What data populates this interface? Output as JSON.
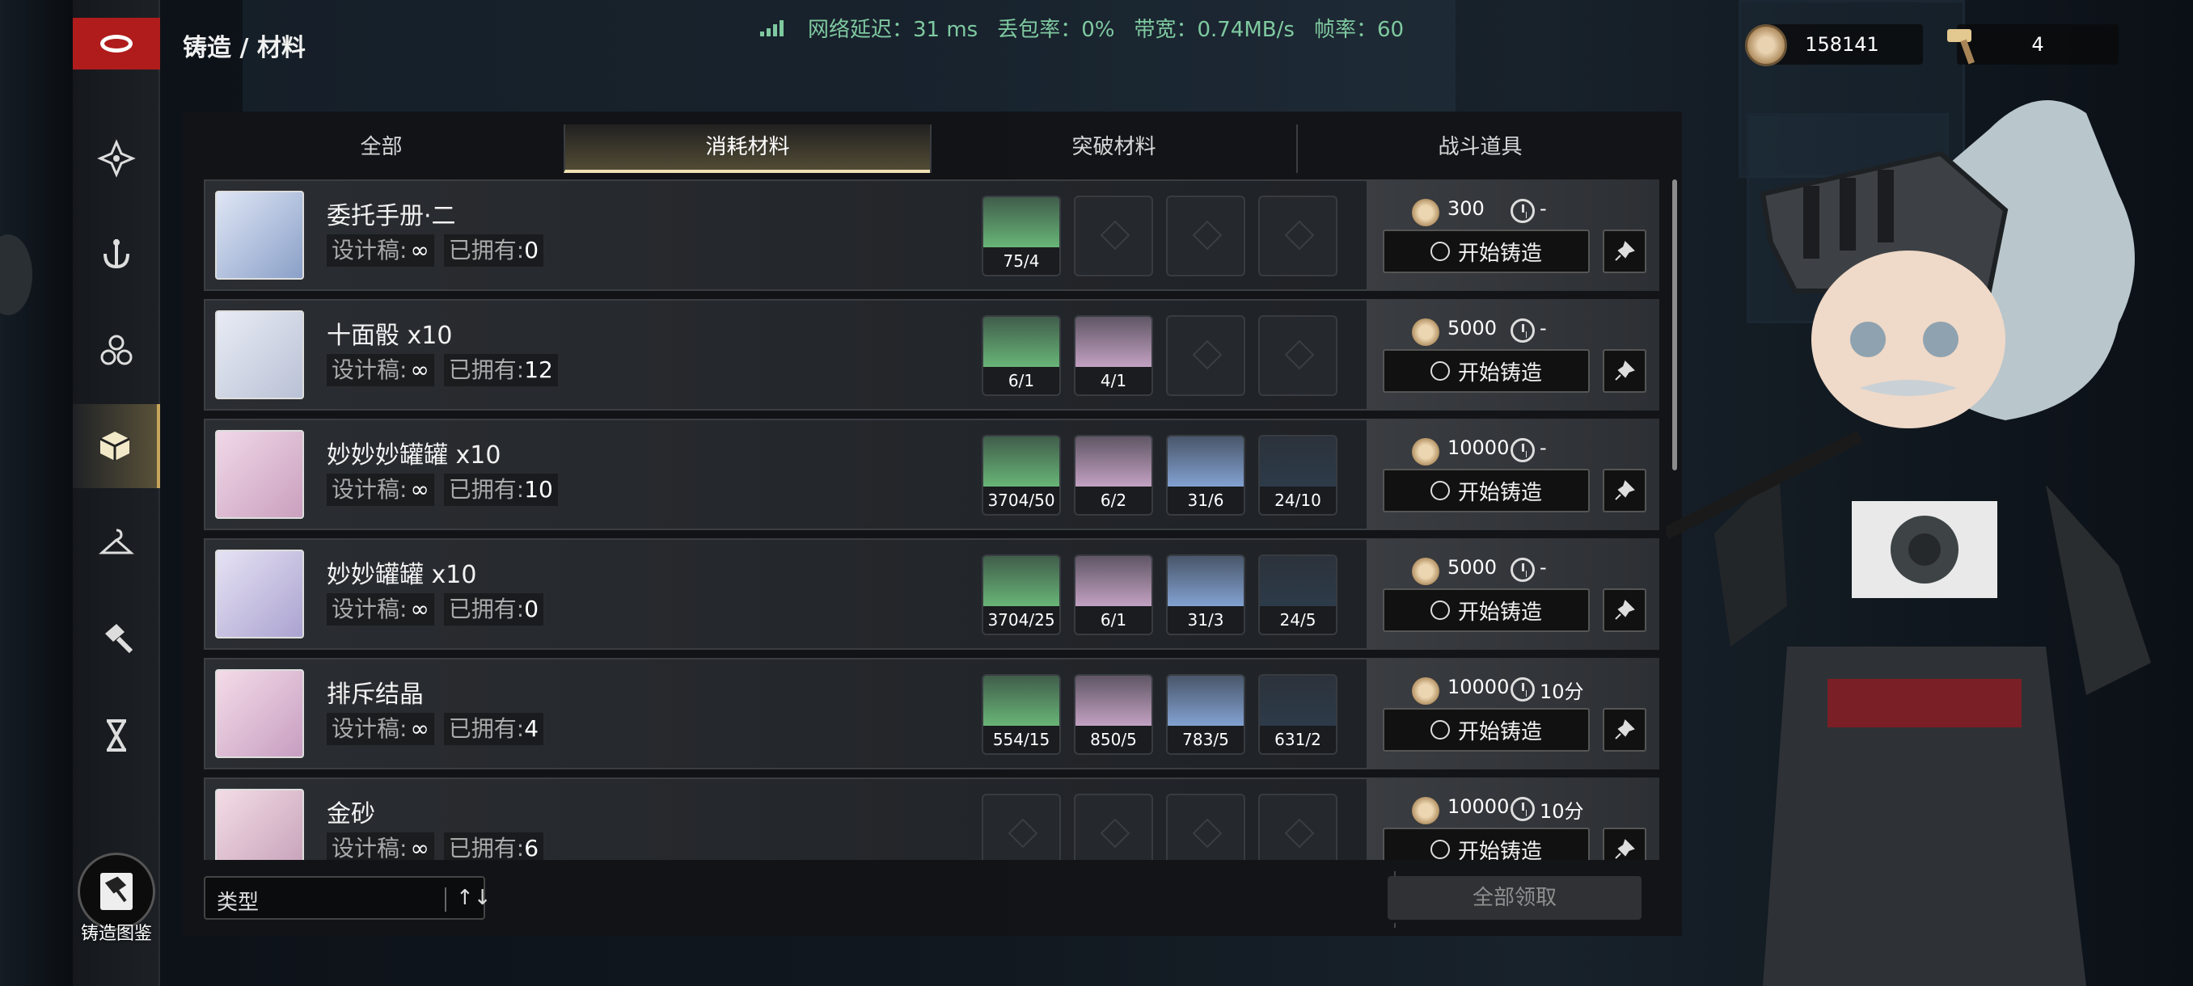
{
  "breadcrumb": "铸造 / 材料",
  "netstat": {
    "latency": "网络延迟：31 ms",
    "loss": "丢包率：0%",
    "bandwidth": "带宽：0.74MB/s",
    "fps": "帧率：60"
  },
  "currency": [
    {
      "icon": "coin-icon",
      "value": "158141"
    },
    {
      "icon": "hammer-icon",
      "value": "4"
    }
  ],
  "tabs": [
    {
      "label": "全部"
    },
    {
      "label": "消耗材料",
      "active": true
    },
    {
      "label": "突破材料"
    },
    {
      "label": "战斗道具"
    }
  ],
  "labels": {
    "design": "设计稿:",
    "owned": "已拥有:",
    "start": "开始铸造"
  },
  "recipes": [
    {
      "name": "委托手册·二",
      "owned": "0",
      "cost": "300",
      "time": "-",
      "materials": [
        "75/4",
        "",
        "",
        ""
      ]
    },
    {
      "name": "十面骰 x10",
      "owned": "12",
      "cost": "5000",
      "time": "-",
      "materials": [
        "6/1",
        "4/1",
        "",
        ""
      ]
    },
    {
      "name": "妙妙妙罐罐 x10",
      "owned": "10",
      "cost": "10000",
      "time": "-",
      "materials": [
        "3704/50",
        "6/2",
        "31/6",
        "24/10"
      ]
    },
    {
      "name": "妙妙罐罐 x10",
      "owned": "0",
      "cost": "5000",
      "time": "-",
      "materials": [
        "3704/25",
        "6/1",
        "31/3",
        "24/5"
      ]
    },
    {
      "name": "排斥结晶",
      "owned": "4",
      "cost": "10000",
      "time": "10分",
      "materials": [
        "554/15",
        "850/5",
        "783/5",
        "631/2"
      ]
    },
    {
      "name": "金砂",
      "owned": "6",
      "cost": "10000",
      "time": "10分",
      "materials": [
        "",
        "",
        "",
        ""
      ]
    }
  ],
  "bottom": {
    "type_filter": "类型",
    "sort_icon": "↑↓",
    "claim_all": "全部领取"
  },
  "handbook": "铸造图鉴",
  "colors": {
    "accent": "#c7a55a",
    "brand_red": "#b01c1c",
    "net_green": "#7fc9a0"
  }
}
